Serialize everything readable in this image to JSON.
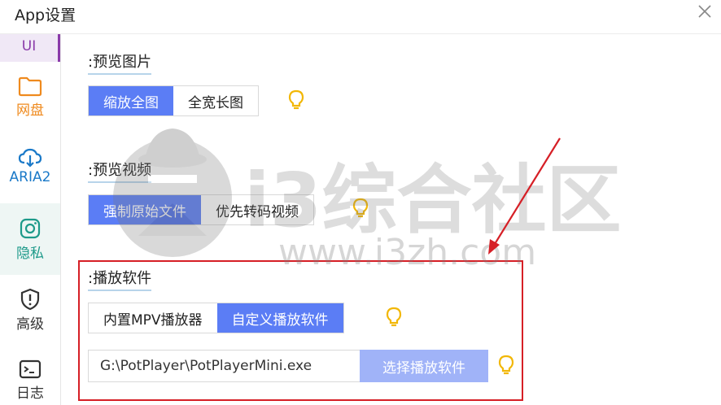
{
  "window": {
    "title": "App设置"
  },
  "sidebar": {
    "items": [
      {
        "label": "UI"
      },
      {
        "label": "网盘"
      },
      {
        "label": "ARIA2"
      },
      {
        "label": "隐私"
      },
      {
        "label": "高级"
      },
      {
        "label": "日志"
      }
    ]
  },
  "sections": {
    "preview_image": {
      "title": ":预览图片",
      "options": [
        "缩放全图",
        "全宽长图"
      ],
      "selected": "缩放全图"
    },
    "preview_video": {
      "title": ":预览视频",
      "options": [
        "强制原始文件",
        "优先转码视频"
      ],
      "selected": "强制原始文件"
    },
    "player": {
      "title": ":播放软件",
      "options": [
        "内置MPV播放器",
        "自定义播放软件"
      ],
      "selected": "自定义播放软件",
      "path_value": "G:\\PotPlayer\\PotPlayerMini.exe",
      "pick_button": "选择播放软件"
    }
  },
  "watermark": {
    "text": "i3综合社区",
    "url": "www.i3zh.com"
  },
  "colors": {
    "accent": "#5b7df5",
    "accent_light": "#a0b3f8",
    "highlight_box": "#d61f26",
    "bulb": "#f2b705"
  },
  "icons": [
    "close-icon",
    "folder-icon",
    "cloud-download-icon",
    "instagram-icon",
    "shield-alert-icon",
    "terminal-icon",
    "lightbulb-icon"
  ]
}
